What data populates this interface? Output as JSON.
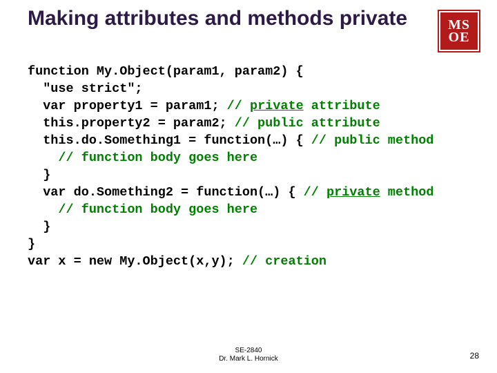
{
  "title": "Making attributes and methods private",
  "logo": {
    "row1": "MS",
    "row2": "OE"
  },
  "code": {
    "l1a": "function My.Object(param1, param2) {",
    "l2a": "\"use strict\";",
    "l3a": "var property1 = param1; ",
    "l3c1": "// ",
    "l3c2": "private",
    "l3c3": " attribute",
    "l4a": "this.property2 = param2; ",
    "l4c": "// public attribute",
    "l5a": "this.do.Something1 = function(…) { ",
    "l5c": "// public method",
    "l6c": "// function body goes here",
    "l7a": "}",
    "l8a": "var do.Something2 = function(…) { ",
    "l8c1": "// ",
    "l8c2": "private",
    "l8c3": " method",
    "l9c": "// function body goes here",
    "l10a": "}",
    "l11a": "}",
    "l12a": "var x = new My.Object(x,y); ",
    "l12c": "// creation"
  },
  "footer": {
    "line1": "SE-2840",
    "line2": "Dr. Mark L. Hornick"
  },
  "pagenum": "28"
}
